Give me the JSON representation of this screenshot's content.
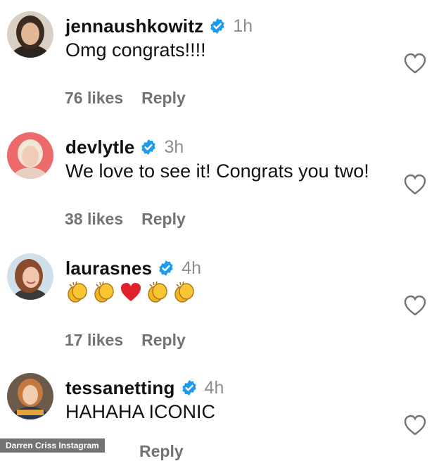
{
  "colors": {
    "verified": "#1d9bf0",
    "muted": "#8e8e8e",
    "text": "#111111"
  },
  "comments": [
    {
      "username": "jennaushkowitz",
      "time": "1h",
      "text": "Omg congrats!!!!",
      "likes": "76 likes",
      "reply": "Reply"
    },
    {
      "username": "devlytle",
      "time": "3h",
      "text": "We love to see it! Congrats you two!",
      "likes": "38 likes",
      "reply": "Reply"
    },
    {
      "username": "laurasnes",
      "time": "4h",
      "emojis": [
        "clapping-hands",
        "clapping-hands",
        "red-heart",
        "clapping-hands",
        "clapping-hands"
      ],
      "likes": "17 likes",
      "reply": "Reply"
    },
    {
      "username": "tessanetting",
      "time": "4h",
      "text": "HAHAHA ICONIC",
      "likes": "",
      "reply": "Reply"
    }
  ],
  "watermark": "Darren Criss Instagram",
  "icons": {
    "verified": "verified-badge-icon",
    "like": "heart-outline-icon"
  }
}
